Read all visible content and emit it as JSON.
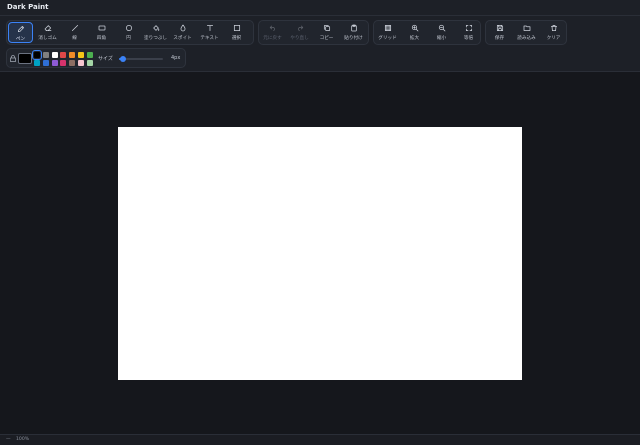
{
  "app": {
    "title": "Dark Paint"
  },
  "tools": [
    {
      "id": "pen",
      "label": "ペン",
      "icon": "pencil-icon",
      "active": true
    },
    {
      "id": "eraser",
      "label": "消しゴム",
      "icon": "eraser-icon"
    },
    {
      "id": "line",
      "label": "線",
      "icon": "line-icon"
    },
    {
      "id": "rect",
      "label": "四角",
      "icon": "rectangle-icon"
    },
    {
      "id": "circle",
      "label": "円",
      "icon": "circle-icon"
    },
    {
      "id": "fill",
      "label": "塗りつぶし",
      "icon": "paint-bucket-icon"
    },
    {
      "id": "eyedropper",
      "label": "スポイト",
      "icon": "droplet-icon"
    },
    {
      "id": "text",
      "label": "テキスト",
      "icon": "text-icon"
    },
    {
      "id": "select",
      "label": "選択",
      "icon": "selection-icon"
    }
  ],
  "edit": [
    {
      "id": "undo",
      "label": "元に戻す",
      "icon": "undo-icon",
      "disabled": true
    },
    {
      "id": "redo",
      "label": "やり直し",
      "icon": "redo-icon",
      "disabled": true
    },
    {
      "id": "copy",
      "label": "コピー",
      "icon": "copy-icon"
    },
    {
      "id": "paste",
      "label": "貼り付け",
      "icon": "paste-icon"
    }
  ],
  "view": [
    {
      "id": "grid",
      "label": "グリッド",
      "icon": "grid-icon"
    },
    {
      "id": "zoomin",
      "label": "拡大",
      "icon": "zoom-in-icon"
    },
    {
      "id": "zoomout",
      "label": "縮小",
      "icon": "zoom-out-icon"
    },
    {
      "id": "fit",
      "label": "等倍",
      "icon": "fullscreen-icon"
    }
  ],
  "file": [
    {
      "id": "save",
      "label": "保存",
      "icon": "save-icon"
    },
    {
      "id": "open",
      "label": "読み込み",
      "icon": "folder-icon"
    },
    {
      "id": "clear",
      "label": "クリア",
      "icon": "trash-icon"
    }
  ],
  "colors": {
    "current": "#000000",
    "palette": [
      "#000000",
      "#808080",
      "#ffffff",
      "#e04848",
      "#f08c28",
      "#f5c518",
      "#4caf50",
      "#00a3c4",
      "#2f6fd6",
      "#8e5bd6",
      "#d6336c",
      "#8d6e63",
      "#f5c6cf",
      "#a5d6a7"
    ],
    "selected_index": 0
  },
  "size": {
    "label": "サイズ",
    "value_text": "4px",
    "level": 0.08
  },
  "status": {
    "left": "—",
    "zoom": "100%"
  }
}
